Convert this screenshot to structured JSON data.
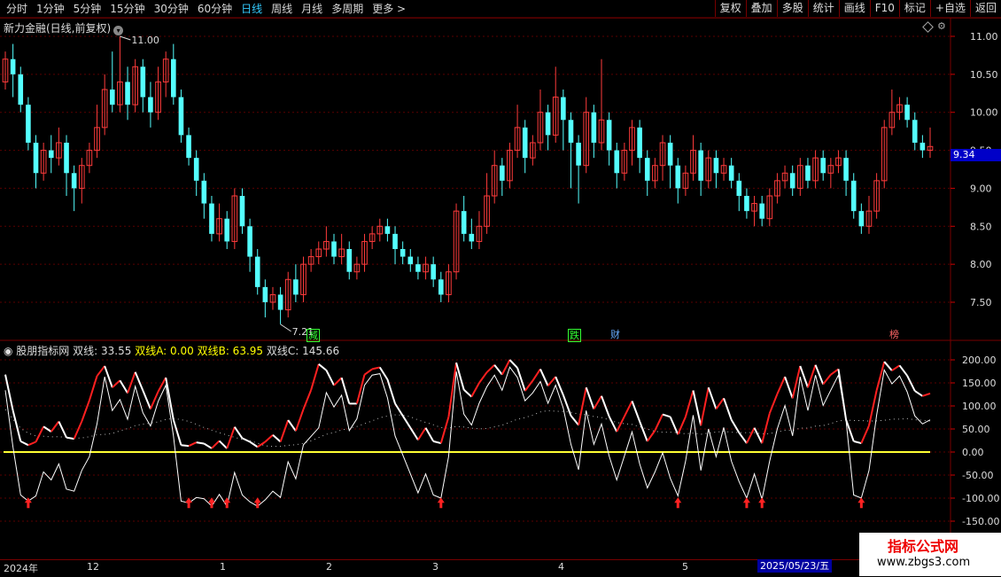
{
  "toolbar": {
    "tabs": [
      "分时",
      "1分钟",
      "5分钟",
      "15分钟",
      "30分钟",
      "60分钟",
      "日线",
      "周线",
      "月线",
      "多周期",
      "更多 >"
    ],
    "active_tab": "日线",
    "tools": [
      "复权",
      "叠加",
      "多股",
      "统计",
      "画线",
      "F10",
      "标记",
      "+自选",
      "返回"
    ]
  },
  "stock": {
    "title": "新力金融(日线,前复权)",
    "max_label": "11.00",
    "min_label": "7.21",
    "current_price": "9.34"
  },
  "price_axis": [
    "11.00",
    "10.50",
    "10.00",
    "9.50",
    "9.00",
    "8.50",
    "8.00",
    "7.50"
  ],
  "indicator": {
    "name": "股朋指标网",
    "items": [
      {
        "label": "双线: 33.55"
      },
      {
        "label": "双线A: 0.00"
      },
      {
        "label": "双线B: 63.95"
      },
      {
        "label": "双线C: 145.66"
      }
    ],
    "axis": [
      "200.00",
      "150.00",
      "100.00",
      "50.00",
      "0.00",
      "-50.00",
      "-100.00",
      "-150.00"
    ]
  },
  "events": [
    {
      "text": "减",
      "color": "#3f3"
    },
    {
      "text": "跌",
      "color": "#3f3"
    },
    {
      "text": "财",
      "color": "#6af"
    },
    {
      "text": "榜",
      "color": "#f66"
    }
  ],
  "dates": [
    "2024年",
    "12",
    "1",
    "2",
    "3",
    "4",
    "5"
  ],
  "cursor_date": "2025/05/23/五",
  "watermark": {
    "title": "指标公式网",
    "url": "www.zbgs3.com"
  },
  "colors": {
    "up": "#ff3b3b",
    "down": "#54ffff",
    "accent": "#3cf",
    "line_white": "#ffffff",
    "line_red": "#ff2020",
    "line_yellow": "#ffff33"
  },
  "chart_data": {
    "type": "candlestick",
    "title": "新力金融(日线,前复权)",
    "ylim": [
      7.21,
      11.0
    ],
    "candles": [
      [
        10.4,
        10.7,
        10.8,
        10.3
      ],
      [
        10.7,
        10.5,
        10.9,
        10.2
      ],
      [
        10.5,
        10.1,
        10.6,
        10.0
      ],
      [
        10.1,
        9.6,
        10.2,
        9.5
      ],
      [
        9.6,
        9.2,
        9.7,
        9.0
      ],
      [
        9.2,
        9.5,
        9.6,
        9.1
      ],
      [
        9.5,
        9.4,
        9.7,
        9.2
      ],
      [
        9.4,
        9.6,
        9.8,
        9.3
      ],
      [
        9.6,
        9.2,
        9.7,
        8.9
      ],
      [
        9.2,
        9.0,
        9.3,
        8.7
      ],
      [
        9.0,
        9.3,
        9.4,
        8.8
      ],
      [
        9.3,
        9.5,
        9.6,
        9.2
      ],
      [
        9.5,
        9.8,
        10.1,
        9.4
      ],
      [
        9.8,
        10.3,
        10.5,
        9.7
      ],
      [
        10.3,
        10.1,
        10.8,
        10.0
      ],
      [
        10.1,
        10.4,
        11.0,
        10.0
      ],
      [
        10.4,
        10.1,
        10.6,
        9.9
      ],
      [
        10.1,
        10.6,
        10.7,
        10.0
      ],
      [
        10.6,
        10.2,
        10.7,
        10.0
      ],
      [
        10.2,
        10.0,
        10.4,
        9.8
      ],
      [
        10.0,
        10.4,
        10.6,
        9.9
      ],
      [
        10.4,
        10.7,
        10.8,
        10.2
      ],
      [
        10.7,
        10.2,
        10.9,
        10.1
      ],
      [
        10.2,
        9.7,
        10.3,
        9.6
      ],
      [
        9.7,
        9.4,
        9.8,
        9.3
      ],
      [
        9.4,
        9.1,
        9.5,
        8.9
      ],
      [
        9.1,
        8.8,
        9.2,
        8.6
      ],
      [
        8.8,
        8.4,
        8.9,
        8.3
      ],
      [
        8.4,
        8.6,
        8.8,
        8.3
      ],
      [
        8.6,
        8.3,
        8.7,
        8.2
      ],
      [
        8.3,
        8.9,
        9.0,
        8.2
      ],
      [
        8.9,
        8.5,
        9.0,
        8.4
      ],
      [
        8.5,
        8.1,
        8.6,
        7.9
      ],
      [
        8.1,
        7.7,
        8.2,
        7.6
      ],
      [
        7.7,
        7.5,
        7.8,
        7.3
      ],
      [
        7.5,
        7.6,
        7.7,
        7.4
      ],
      [
        7.6,
        7.4,
        7.7,
        7.21
      ],
      [
        7.4,
        7.8,
        7.9,
        7.3
      ],
      [
        7.8,
        7.6,
        8.0,
        7.5
      ],
      [
        7.6,
        8.0,
        8.1,
        7.5
      ],
      [
        8.0,
        8.1,
        8.2,
        7.9
      ],
      [
        8.1,
        8.2,
        8.3,
        8.0
      ],
      [
        8.2,
        8.3,
        8.5,
        8.1
      ],
      [
        8.3,
        8.1,
        8.4,
        8.0
      ],
      [
        8.1,
        8.2,
        8.4,
        8.0
      ],
      [
        8.2,
        7.9,
        8.3,
        7.8
      ],
      [
        7.9,
        8.0,
        8.1,
        7.8
      ],
      [
        8.0,
        8.3,
        8.4,
        7.9
      ],
      [
        8.3,
        8.4,
        8.5,
        8.2
      ],
      [
        8.4,
        8.5,
        8.6,
        8.3
      ],
      [
        8.5,
        8.4,
        8.6,
        8.3
      ],
      [
        8.4,
        8.2,
        8.5,
        8.0
      ],
      [
        8.2,
        8.1,
        8.3,
        8.0
      ],
      [
        8.1,
        8.0,
        8.2,
        7.9
      ],
      [
        8.0,
        7.9,
        8.1,
        7.8
      ],
      [
        7.9,
        8.0,
        8.1,
        7.8
      ],
      [
        8.0,
        7.8,
        8.1,
        7.7
      ],
      [
        7.8,
        7.6,
        7.9,
        7.5
      ],
      [
        7.6,
        7.9,
        8.0,
        7.5
      ],
      [
        7.9,
        8.7,
        8.8,
        7.8
      ],
      [
        8.7,
        8.4,
        8.9,
        8.3
      ],
      [
        8.4,
        8.3,
        8.6,
        8.2
      ],
      [
        8.3,
        8.5,
        8.7,
        8.2
      ],
      [
        8.5,
        8.9,
        9.2,
        8.4
      ],
      [
        8.9,
        9.3,
        9.5,
        8.8
      ],
      [
        9.3,
        9.1,
        9.4,
        8.9
      ],
      [
        9.1,
        9.5,
        9.6,
        9.0
      ],
      [
        9.5,
        9.8,
        10.1,
        9.4
      ],
      [
        9.8,
        9.4,
        9.9,
        9.2
      ],
      [
        9.4,
        9.6,
        9.7,
        9.3
      ],
      [
        9.6,
        10.0,
        10.3,
        9.5
      ],
      [
        10.0,
        9.7,
        10.1,
        9.5
      ],
      [
        9.7,
        10.2,
        10.6,
        9.6
      ],
      [
        10.2,
        9.9,
        10.3,
        9.5
      ],
      [
        9.9,
        9.6,
        10.0,
        9.0
      ],
      [
        9.6,
        9.3,
        9.7,
        8.8
      ],
      [
        9.3,
        10.0,
        10.2,
        9.2
      ],
      [
        10.0,
        9.6,
        10.1,
        9.4
      ],
      [
        9.6,
        9.9,
        10.7,
        9.5
      ],
      [
        9.9,
        9.5,
        10.0,
        9.3
      ],
      [
        9.5,
        9.2,
        9.6,
        9.0
      ],
      [
        9.2,
        9.5,
        9.6,
        9.1
      ],
      [
        9.5,
        9.8,
        9.9,
        9.3
      ],
      [
        9.8,
        9.4,
        9.9,
        9.2
      ],
      [
        9.4,
        9.1,
        9.5,
        8.9
      ],
      [
        9.1,
        9.3,
        9.4,
        9.0
      ],
      [
        9.3,
        9.6,
        9.7,
        9.1
      ],
      [
        9.6,
        9.3,
        9.7,
        9.0
      ],
      [
        9.3,
        9.0,
        9.4,
        8.8
      ],
      [
        9.0,
        9.2,
        9.3,
        8.9
      ],
      [
        9.2,
        9.5,
        9.7,
        9.1
      ],
      [
        9.5,
        9.1,
        9.6,
        8.9
      ],
      [
        9.1,
        9.4,
        9.5,
        9.0
      ],
      [
        9.4,
        9.2,
        9.5,
        9.0
      ],
      [
        9.2,
        9.3,
        9.4,
        9.1
      ],
      [
        9.3,
        9.1,
        9.4,
        9.0
      ],
      [
        9.1,
        8.9,
        9.2,
        8.7
      ],
      [
        8.9,
        8.7,
        9.0,
        8.6
      ],
      [
        8.7,
        8.8,
        8.9,
        8.5
      ],
      [
        8.8,
        8.6,
        8.9,
        8.5
      ],
      [
        8.6,
        8.9,
        9.0,
        8.5
      ],
      [
        8.9,
        9.1,
        9.2,
        8.8
      ],
      [
        9.1,
        9.2,
        9.3,
        9.0
      ],
      [
        9.2,
        9.0,
        9.3,
        8.9
      ],
      [
        9.0,
        9.3,
        9.4,
        8.9
      ],
      [
        9.3,
        9.1,
        9.4,
        9.0
      ],
      [
        9.1,
        9.4,
        9.5,
        9.0
      ],
      [
        9.4,
        9.2,
        9.5,
        9.1
      ],
      [
        9.2,
        9.3,
        9.4,
        9.0
      ],
      [
        9.3,
        9.4,
        9.5,
        9.2
      ],
      [
        9.4,
        9.1,
        9.5,
        8.9
      ],
      [
        9.1,
        8.7,
        9.2,
        8.6
      ],
      [
        8.7,
        8.5,
        8.8,
        8.4
      ],
      [
        8.5,
        8.7,
        8.9,
        8.4
      ],
      [
        8.7,
        9.1,
        9.2,
        8.6
      ],
      [
        9.1,
        9.8,
        9.9,
        9.0
      ],
      [
        9.8,
        10.0,
        10.3,
        9.7
      ],
      [
        10.0,
        10.1,
        10.2,
        9.9
      ],
      [
        10.1,
        9.9,
        10.2,
        9.8
      ],
      [
        9.9,
        9.6,
        10.0,
        9.5
      ],
      [
        9.6,
        9.5,
        9.7,
        9.4
      ],
      [
        9.5,
        9.55,
        9.8,
        9.4
      ]
    ],
    "indicator_series": [
      {
        "name": "双线",
        "color": "white"
      },
      {
        "name": "双线A",
        "color": "yellow"
      },
      {
        "name": "双线B",
        "color": "red"
      },
      {
        "name": "双线C",
        "color": "white"
      }
    ],
    "indicator_ylim": [
      -150,
      200
    ]
  }
}
